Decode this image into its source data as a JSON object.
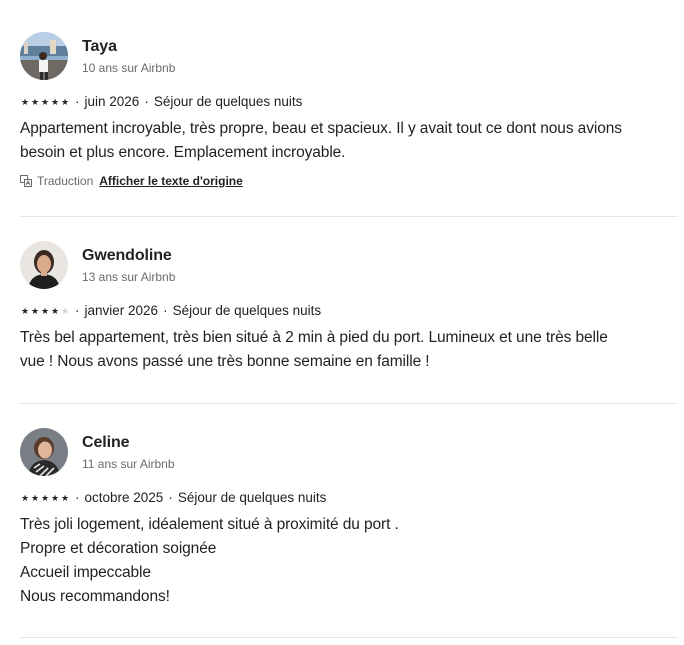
{
  "reviews": [
    {
      "name": "Taya",
      "tenure": "10 ans sur Airbnb",
      "rating": 5,
      "date": "juin 2026",
      "stay": "Séjour de quelques nuits",
      "lines": [
        "Appartement incroyable, très propre, beau et spacieux. Il y avait tout ce dont nous avions",
        "besoin et plus encore. Emplacement incroyable."
      ],
      "translation_label": "Traduction",
      "show_original_label": "Afficher le texte d'origine",
      "avatar_icon": "profile-photo"
    },
    {
      "name": "Gwendoline",
      "tenure": "13 ans sur Airbnb",
      "rating": 4,
      "date": "janvier 2026",
      "stay": "Séjour de quelques nuits",
      "lines": [
        "Très bel appartement, très bien situé à 2 min à pied du port. Lumineux et une très belle",
        "vue ! Nous avons passé une très bonne semaine en famille !"
      ],
      "avatar_icon": "profile-photo"
    },
    {
      "name": "Celine",
      "tenure": "11 ans sur Airbnb",
      "rating": 5,
      "date": "octobre 2025",
      "stay": "Séjour de quelques nuits",
      "lines": [
        "Très joli logement, idéalement situé à proximité du port .",
        "Propre et décoration soignée",
        "Accueil impeccable",
        "Nous recommandons!"
      ],
      "avatar_icon": "profile-photo"
    }
  ],
  "separator": "·",
  "star_glyph": "★",
  "colors": {
    "text": "#222222",
    "muted": "#6a6a6a",
    "star_on": "#222222",
    "star_off": "#d0d0d0",
    "divider": "#e6e6e6"
  }
}
